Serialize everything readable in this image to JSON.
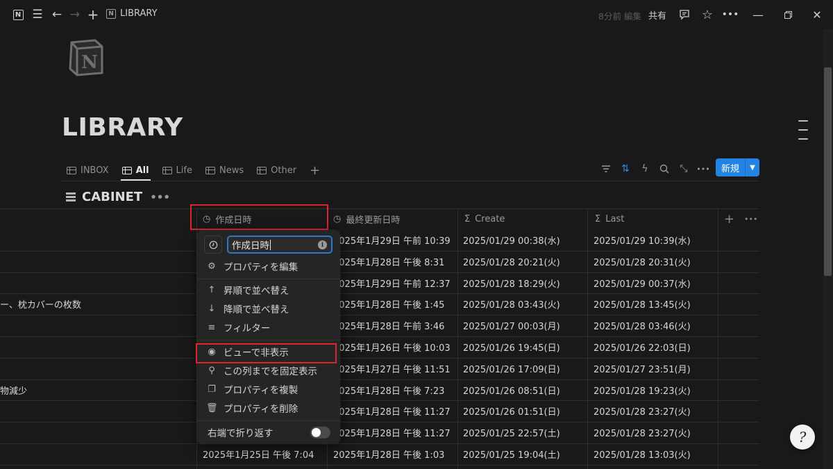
{
  "topbar": {
    "breadcrumb": "LIBRARY",
    "edited": "8分前 編集",
    "share": "共有"
  },
  "page": {
    "title": "LIBRARY"
  },
  "views": {
    "tabs": [
      {
        "label": "INBOX",
        "active": false
      },
      {
        "label": "All",
        "active": true
      },
      {
        "label": "Life",
        "active": false
      },
      {
        "label": "News",
        "active": false
      },
      {
        "label": "Other",
        "active": false
      }
    ],
    "new_label": "新規"
  },
  "database": {
    "title": "CABINET",
    "columns": [
      "作成日時",
      "最終更新日時",
      "Create",
      "Last"
    ],
    "rows": [
      {
        "name": "",
        "created": "",
        "updated": "2025年1月29日 午前 10:39",
        "create": "2025/01/29 00:38(水)",
        "last": "2025/01/29 10:39(水)"
      },
      {
        "name": "",
        "created": "",
        "updated": "2025年1月28日 午後 8:31",
        "create": "2025/01/28 20:21(火)",
        "last": "2025/01/28 20:31(火)"
      },
      {
        "name": "",
        "created": "",
        "updated": "2025年1月29日 午前 12:37",
        "create": "2025/01/28 18:29(火)",
        "last": "2025/01/29 00:37(水)"
      },
      {
        "name": "ー、枕カバーの枚数",
        "created": "",
        "updated": "2025年1月28日 午後 1:45",
        "create": "2025/01/28 03:43(火)",
        "last": "2025/01/28 13:45(火)"
      },
      {
        "name": "",
        "created": "",
        "updated": "2025年1月28日 午前 3:46",
        "create": "2025/01/27 00:03(月)",
        "last": "2025/01/28 03:46(火)"
      },
      {
        "name": "",
        "created": "",
        "updated": "2025年1月26日 午後 10:03",
        "create": "2025/01/26 19:45(日)",
        "last": "2025/01/26 22:03(日)"
      },
      {
        "name": "",
        "created": "",
        "updated": "2025年1月27日 午後 11:51",
        "create": "2025/01/26 17:09(日)",
        "last": "2025/01/27 23:51(月)"
      },
      {
        "name": "物減少",
        "created": "",
        "updated": "2025年1月28日 午後 7:23",
        "create": "2025/01/26 08:51(日)",
        "last": "2025/01/28 19:23(火)"
      },
      {
        "name": "",
        "created": "",
        "updated": "2025年1月28日 午後 11:27",
        "create": "2025/01/26 01:51(日)",
        "last": "2025/01/28 23:27(火)"
      },
      {
        "name": "",
        "created": "",
        "updated": "2025年1月28日 午後 11:27",
        "create": "2025/01/25 22:57(土)",
        "last": "2025/01/28 23:27(火)"
      },
      {
        "name": "",
        "created": "2025年1月25日 午後 7:04",
        "updated": "2025年1月28日 午後 1:03",
        "create": "2025/01/25 19:04(土)",
        "last": "2025/01/28 13:03(火)"
      }
    ]
  },
  "menu": {
    "input_value": "作成日時",
    "items": [
      {
        "label": "プロパティを編集",
        "icon": "sliders-icon"
      },
      {
        "label": "昇順で並べ替え",
        "icon": "arrow-up-icon"
      },
      {
        "label": "降順で並べ替え",
        "icon": "arrow-down-icon"
      },
      {
        "label": "フィルター",
        "icon": "filter-icon"
      },
      {
        "label": "ビューで非表示",
        "icon": "eye-slash-icon"
      },
      {
        "label": "この列までを固定表示",
        "icon": "pin-icon"
      },
      {
        "label": "プロパティを複製",
        "icon": "duplicate-icon"
      },
      {
        "label": "プロパティを削除",
        "icon": "trash-icon"
      }
    ],
    "wrap_label": "右端で折り返す",
    "wrap_enabled": false
  },
  "colors": {
    "accent": "#2383e2",
    "highlight": "#e0242f",
    "background": "#191919"
  }
}
